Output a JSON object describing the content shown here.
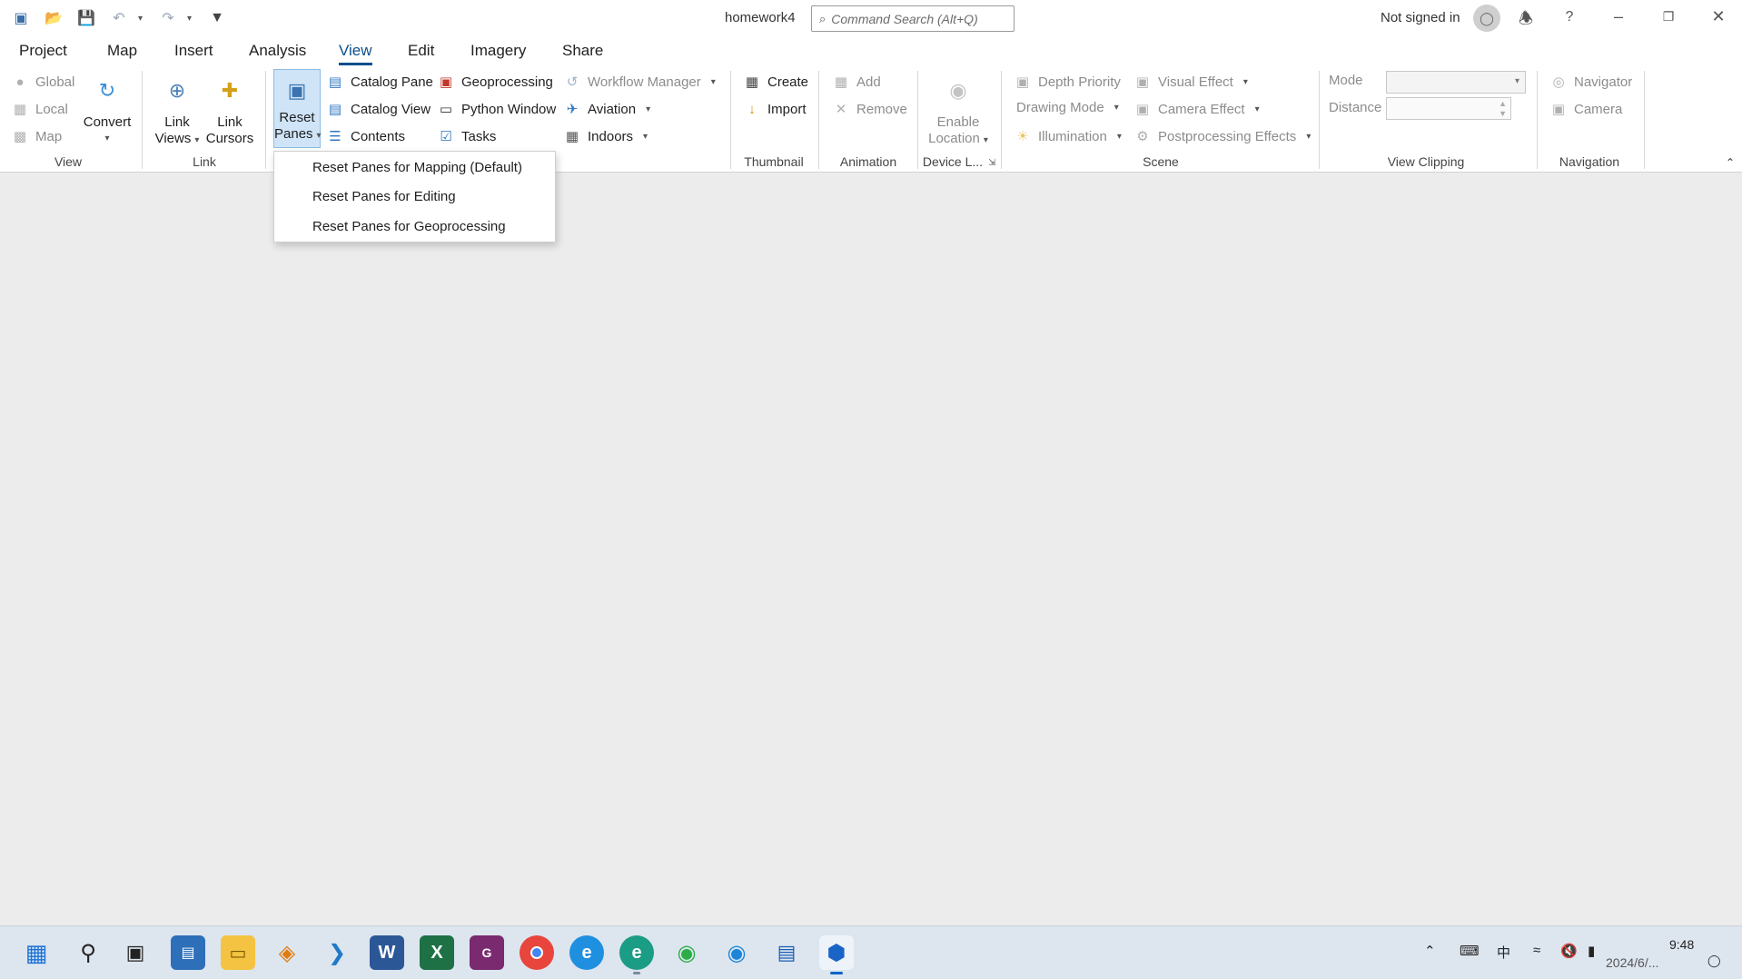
{
  "window": {
    "title": "homework4",
    "search_placeholder": "Command Search (Alt+Q)",
    "signin_status": "Not signed in"
  },
  "menu": {
    "tabs": [
      "Project",
      "Map",
      "Insert",
      "Analysis",
      "View",
      "Edit",
      "Imagery",
      "Share"
    ],
    "active": "View"
  },
  "ribbon": {
    "view_group": {
      "label": "View",
      "global": "Global",
      "local": "Local",
      "map": "Map",
      "convert": "Convert"
    },
    "link_group": {
      "label": "Link",
      "link_views_1": "Link",
      "link_views_2": "Views",
      "link_cursors_1": "Link",
      "link_cursors_2": "Cursors"
    },
    "windows_group": {
      "reset_panes_1": "Reset",
      "reset_panes_2": "Panes",
      "catalog_pane": "Catalog Pane",
      "catalog_view": "Catalog View",
      "contents": "Contents",
      "geoprocessing": "Geoprocessing",
      "python_window": "Python Window",
      "tasks": "Tasks",
      "workflow_manager": "Workflow Manager",
      "aviation": "Aviation",
      "indoors": "Indoors"
    },
    "thumbnail_group": {
      "label": "Thumbnail",
      "create": "Create",
      "import": "Import"
    },
    "animation_group": {
      "label": "Animation",
      "add": "Add",
      "remove": "Remove"
    },
    "device_group": {
      "label": "Device L...",
      "enable_1": "Enable",
      "enable_2": "Location"
    },
    "scene_group": {
      "label": "Scene",
      "depth_priority": "Depth Priority",
      "drawing_mode": "Drawing Mode",
      "illumination": "Illumination",
      "visual_effect": "Visual Effect",
      "camera_effect": "Camera Effect",
      "postprocessing": "Postprocessing Effects"
    },
    "clipping_group": {
      "label": "View Clipping",
      "mode": "Mode",
      "distance": "Distance"
    },
    "navigation_group": {
      "label": "Navigation",
      "navigator": "Navigator",
      "camera": "Camera"
    }
  },
  "dropdown": {
    "items": [
      "Reset Panes for Mapping (Default)",
      "Reset Panes for Editing",
      "Reset Panes for Geoprocessing"
    ]
  },
  "taskbar": {
    "tray_ime": "中",
    "clock": "9:48",
    "date": "2024/6/..."
  },
  "colors": {
    "accent": "#0a4f8c",
    "ribbon_bg": "#ffffff",
    "workspace_bg": "#ececec",
    "taskbar_bg": "#dde5ef"
  }
}
